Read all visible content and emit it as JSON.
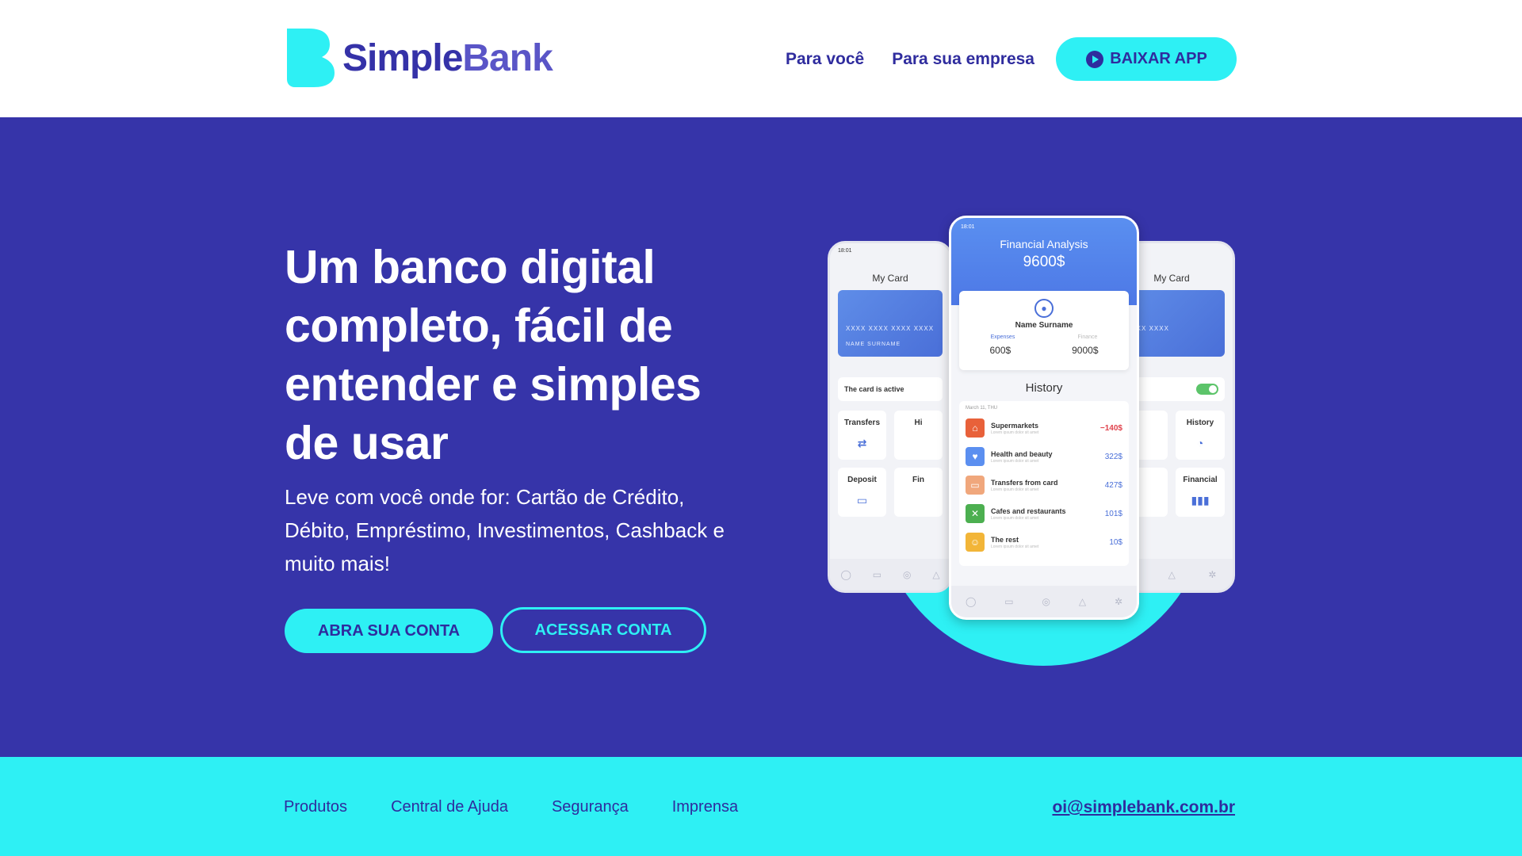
{
  "brand": {
    "name_main": "Simple",
    "name_light": "Bank"
  },
  "nav": {
    "items": [
      "Para você",
      "Para sua empresa"
    ],
    "cta": "BAIXAR APP"
  },
  "hero": {
    "title": "Um banco digital completo, fácil de entender e simples de usar",
    "subtitle": "Leve com você onde for: Cartão de Crédito, Débito, Empréstimo, Investimentos, Cashback e muito mais!",
    "primary_button": "ABRA SUA CONTA",
    "secondary_button": "ACESSAR CONTA"
  },
  "phone_left": {
    "time": "18:01",
    "title": "My Card",
    "card_number": "XXXX XXXX XXXX XXXX",
    "card_name": "NAME SURNAME",
    "card_status": "The card is active",
    "tiles": [
      "Transfers",
      "Hi",
      "Deposit",
      "Fin"
    ]
  },
  "phone_right": {
    "title": "My Card",
    "card_number": "XXXX XXXX",
    "card_status": "tive",
    "tiles": [
      "",
      "History",
      "",
      "Financial"
    ]
  },
  "phone_center": {
    "time": "18:01",
    "title": "Financial Analysis",
    "amount": "9600$",
    "user_name": "Name Surname",
    "label_expenses": "Expenses",
    "label_income": "Finance",
    "value_expenses": "600$",
    "value_income": "9000$",
    "history_title": "History",
    "date": "March 11, THU",
    "transactions": [
      {
        "name": "Supermarkets",
        "desc": "Lorem ipsum dolor sit amet",
        "amount": "−140$",
        "color": "#e8613a"
      },
      {
        "name": "Health and beauty",
        "desc": "Lorem ipsum dolor sit amet",
        "amount": "322$",
        "color": "#5b8ff0"
      },
      {
        "name": "Transfers from card",
        "desc": "Lorem ipsum dolor sit amet",
        "amount": "427$",
        "color": "#f0a77c"
      },
      {
        "name": "Cafes and restaurants",
        "desc": "Lorem ipsum dolor sit amet",
        "amount": "101$",
        "color": "#4caf50"
      },
      {
        "name": "The rest",
        "desc": "Lorem ipsum dolor sit amet",
        "amount": "10$",
        "color": "#f2b538"
      }
    ]
  },
  "footer": {
    "links": [
      "Produtos",
      "Central de Ajuda",
      "Segurança",
      "Imprensa"
    ],
    "email": "oi@simplebank.com.br"
  },
  "colors": {
    "primary": "#3634a9",
    "accent": "#2ef0f4",
    "text_dark": "#2f2c9e"
  }
}
